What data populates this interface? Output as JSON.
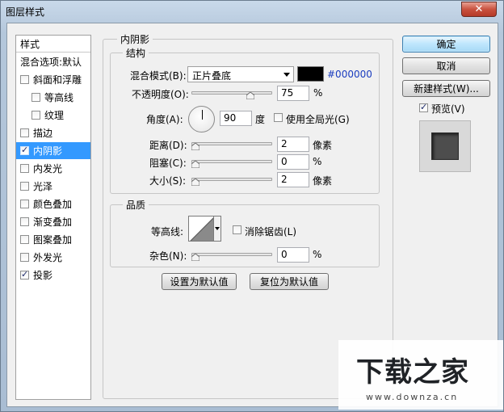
{
  "window": {
    "title": "图层样式",
    "close_glyph": "✕"
  },
  "left_panel": {
    "header": "样式",
    "items": [
      {
        "label": "混合选项:默认",
        "checkbox": false,
        "checked": false,
        "selected": false,
        "indent": false
      },
      {
        "label": "斜面和浮雕",
        "checkbox": true,
        "checked": false,
        "selected": false,
        "indent": false
      },
      {
        "label": "等高线",
        "checkbox": true,
        "checked": false,
        "selected": false,
        "indent": true
      },
      {
        "label": "纹理",
        "checkbox": true,
        "checked": false,
        "selected": false,
        "indent": true
      },
      {
        "label": "描边",
        "checkbox": true,
        "checked": false,
        "selected": false,
        "indent": false
      },
      {
        "label": "内阴影",
        "checkbox": true,
        "checked": true,
        "selected": true,
        "indent": false
      },
      {
        "label": "内发光",
        "checkbox": true,
        "checked": false,
        "selected": false,
        "indent": false
      },
      {
        "label": "光泽",
        "checkbox": true,
        "checked": false,
        "selected": false,
        "indent": false
      },
      {
        "label": "颜色叠加",
        "checkbox": true,
        "checked": false,
        "selected": false,
        "indent": false
      },
      {
        "label": "渐变叠加",
        "checkbox": true,
        "checked": false,
        "selected": false,
        "indent": false
      },
      {
        "label": "图案叠加",
        "checkbox": true,
        "checked": false,
        "selected": false,
        "indent": false
      },
      {
        "label": "外发光",
        "checkbox": true,
        "checked": false,
        "selected": false,
        "indent": false
      },
      {
        "label": "投影",
        "checkbox": true,
        "checked": true,
        "selected": false,
        "indent": false
      }
    ]
  },
  "main": {
    "section_title": "内阴影",
    "structure": {
      "title": "结构",
      "blend_mode_label": "混合模式(B):",
      "blend_mode_value": "正片叠底",
      "color_hex": "#000000",
      "opacity_label": "不透明度(O):",
      "opacity_value": "75",
      "opacity_unit": "%",
      "opacity_fraction": 0.75,
      "angle_label": "角度(A):",
      "angle_value": "90",
      "angle_unit": "度",
      "global_light_label": "使用全局光(G)",
      "global_light_checked": false,
      "distance_label": "距离(D):",
      "distance_value": "2",
      "distance_unit": "像素",
      "choke_label": "阻塞(C):",
      "choke_value": "0",
      "choke_unit": "%",
      "size_label": "大小(S):",
      "size_value": "2",
      "size_unit": "像素"
    },
    "quality": {
      "title": "品质",
      "contour_label": "等高线:",
      "antialias_label": "消除锯齿(L)",
      "antialias_checked": false,
      "noise_label": "杂色(N):",
      "noise_value": "0",
      "noise_unit": "%"
    },
    "make_default_label": "设置为默认值",
    "reset_default_label": "复位为默认值"
  },
  "right_panel": {
    "ok_label": "确定",
    "cancel_label": "取消",
    "new_style_label": "新建样式(W)...",
    "preview_label": "预览(V)",
    "preview_checked": true
  },
  "watermark": {
    "brand": "下载之家",
    "url": "www.downza.cn"
  },
  "colors": {
    "selection": "#3399ff",
    "hex_text": "#1a3cbf",
    "swatch": "#000000"
  }
}
